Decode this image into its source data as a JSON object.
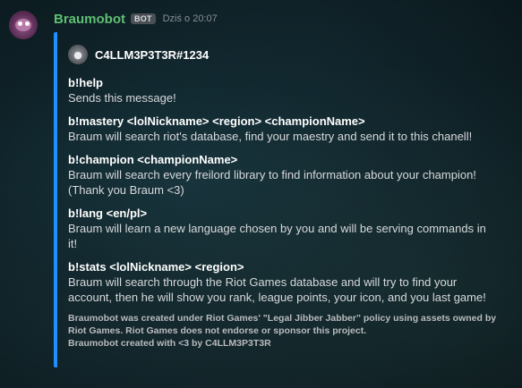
{
  "message": {
    "username": "Braumobot",
    "bot_tag": "BOT",
    "timestamp": "Dziś o 20:07",
    "avatar_icon": "braum-avatar-icon"
  },
  "embed": {
    "accent_color": "#1e90ff",
    "author": {
      "name": "C4LLM3P3T3R#1234",
      "avatar_icon": "author-avatar-icon"
    },
    "fields": [
      {
        "name": "b!help",
        "value": "Sends this message!"
      },
      {
        "name": "b!mastery <lolNickname> <region> <championName>",
        "value": "Braum will search riot's database, find your maestry and send it to this chanell!"
      },
      {
        "name": "b!champion <championName>",
        "value_lines": [
          "Braum will search every freilord library to find information about your champion!",
          "(Thank you Braum <3)"
        ]
      },
      {
        "name": "b!lang <en/pl>",
        "value": "Braum will learn a new language chosen by you and will be serving commands in it!"
      },
      {
        "name": "b!stats <lolNickname> <region>",
        "value_lines": [
          "Braum will search through the Riot Games database and will try to find your",
          "account, then he will show you rank, league points, your icon, and you last game!"
        ]
      }
    ],
    "footer_lines": [
      "Braumobot was created under Riot Games' \"Legal Jibber Jabber\" policy using assets owned by",
      "Riot Games. Riot Games does not endorse or sponsor this project.",
      "Braumobot created with <3 by C4LLM3P3T3R"
    ]
  }
}
